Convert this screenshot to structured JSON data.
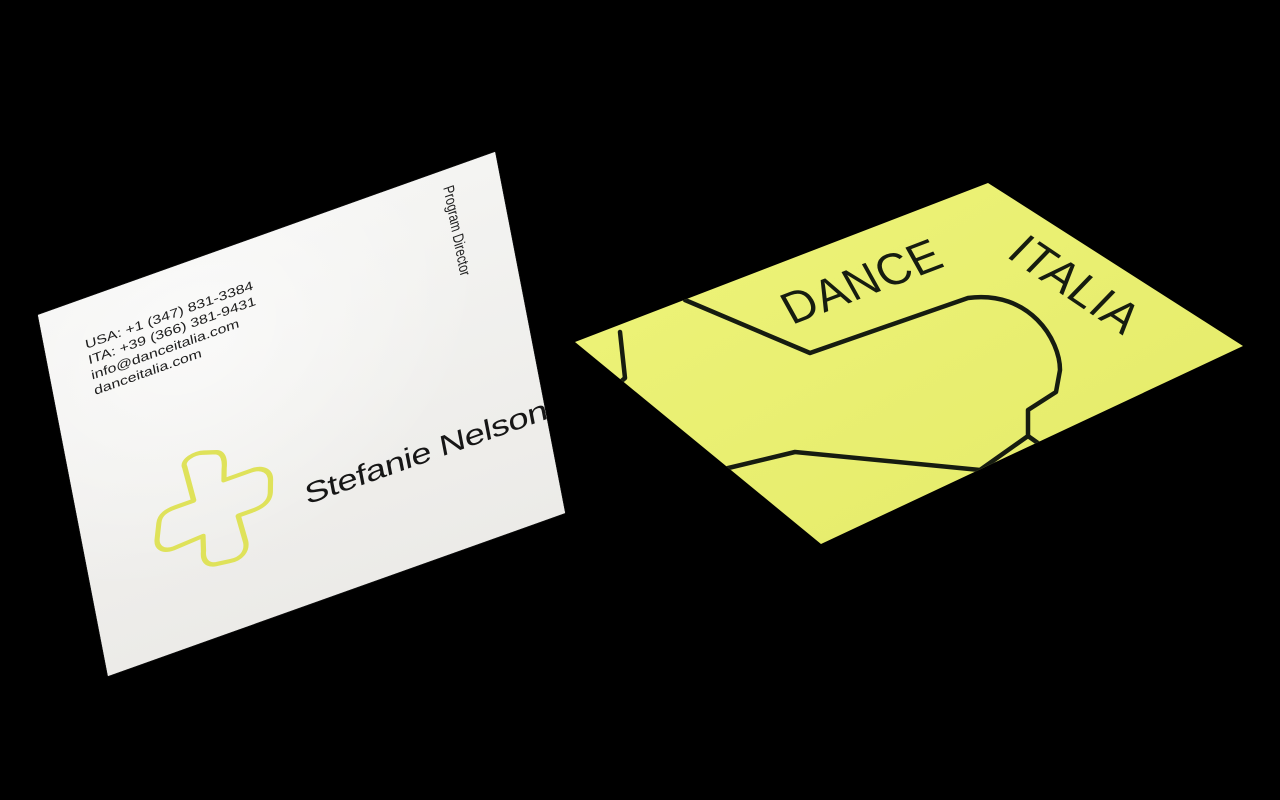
{
  "scene": {
    "background_color": "#000000"
  },
  "front_card": {
    "paper_color": "#f1f1ef",
    "contact": {
      "usa_phone": "USA: +1 (347) 831-3384",
      "ita_phone": "ITA: +39 (366) 381-9431",
      "email": "info@danceitalia.com",
      "website": "danceitalia.com"
    },
    "job_title": "Program Director",
    "name": "Stefanie Nelson",
    "logo_icon": "cross-outline-logo-icon",
    "logo_color": "#dfe25a"
  },
  "back_card": {
    "card_color": "#e9ef71",
    "line_color": "#161c10",
    "brand_word_1": "DANCE",
    "brand_word_2": "ITALIA"
  }
}
